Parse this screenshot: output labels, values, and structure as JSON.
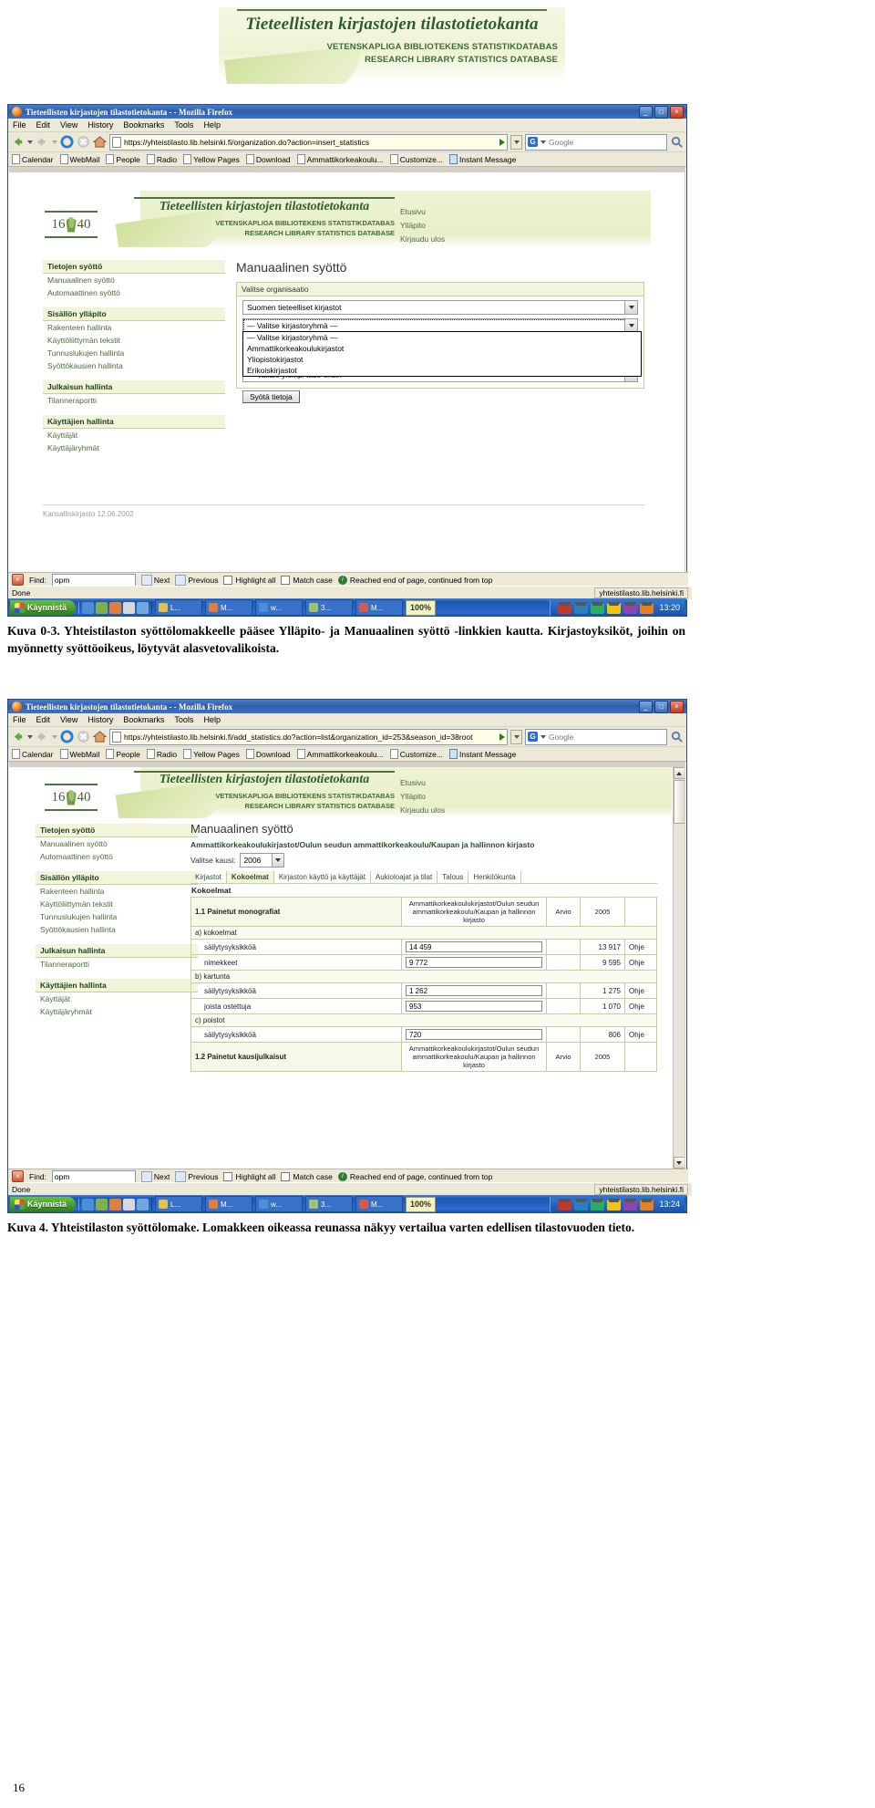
{
  "document": {
    "page_number": "16"
  },
  "top_banner": {
    "title": "Tieteellisten kirjastojen tilastotietokanta",
    "subtitle_sv": "VETENSKAPLIGA BIBLIOTEKENS STATISTIKDATABAS",
    "subtitle_en": "RESEARCH LIBRARY STATISTICS DATABASE"
  },
  "screenshot1": {
    "window": {
      "title": "Tieteellisten kirjastojen tilastotietokanta - - Mozilla Firefox",
      "minimize": "_",
      "maximize": "□",
      "close": "×"
    },
    "menu": [
      "File",
      "Edit",
      "View",
      "History",
      "Bookmarks",
      "Tools",
      "Help"
    ],
    "url": "https://yhteistilasto.lib.helsinki.fi/organization.do?action=insert_statistics",
    "search_engine": "Google",
    "bookmarks": [
      "Calendar",
      "WebMail",
      "People",
      "Radio",
      "Yellow Pages",
      "Download",
      "Ammattikorkeakoulu...",
      "Customize...",
      "Instant Message"
    ],
    "page": {
      "banner": {
        "title": "Tieteellisten kirjastojen tilastotietokanta",
        "subtitle_sv": "VETENSKAPLIGA BIBLIOTEKENS STATISTIKDATABAS",
        "subtitle_en": "RESEARCH LIBRARY STATISTICS DATABASE",
        "logo_left": "16",
        "logo_right": "40",
        "nav": [
          "Etusivu",
          "Ylläpito",
          "Kirjaudu ulos"
        ]
      },
      "sidebar": [
        {
          "heading": "Tietojen syöttö",
          "items": [
            "Manuaalinen syöttö",
            "Automaattinen syöttö"
          ]
        },
        {
          "heading": "Sisällön ylläpito",
          "items": [
            "Rakenteen hallinta",
            "Käyttöliittymän tekstit",
            "Tunnuslukujen hallinta",
            "Syöttökausien hallinta"
          ]
        },
        {
          "heading": "Julkaisun hallinta",
          "items": [
            "Tilanneraportti"
          ]
        },
        {
          "heading": "Käyttäjien hallinta",
          "items": [
            "Käyttäjät",
            "Käyttäjäryhmät"
          ]
        }
      ],
      "footer": "Kansalliskirjasto 12.06.2002",
      "main": {
        "heading": "Manuaalinen syöttö",
        "panel_title": "Valitse organisaatio",
        "select_top_value": "Suomen tieteelliset kirjastot",
        "select_open_value": "— Valitse kirjastoryhmä —",
        "options": [
          "— Valitse kirjastoryhmä —",
          "Ammattikorkeakoulukirjastot",
          "Yliopistokirjastot",
          "Erikoiskirjastot"
        ],
        "select_bottom_value": "— Valitse ylempi taso ensin —",
        "submit_label": "Syötä tietoja"
      }
    },
    "findbar": {
      "close": "×",
      "label": "Find:",
      "value": "opm",
      "next": "Next",
      "previous": "Previous",
      "highlight_all": "Highlight all",
      "match_case": "Match case",
      "message": "Reached end of page, continued from top"
    },
    "statusbar": {
      "status": "Done",
      "host": "yhteistilasto.lib.helsinki.fi"
    },
    "taskbar": {
      "start": "Käynnistä",
      "tasks": [
        "L...",
        "M...",
        "w...",
        "3...",
        "M..."
      ],
      "zoom": "100%",
      "clock": "13:20"
    }
  },
  "caption1": {
    "figure": "Kuva 0-3.",
    "text": "Yhteistilaston syöttölomakkeelle pääsee Ylläpito- ja Manuaalinen syöttö -linkkien kautta. Kirjastoyksiköt, joihin on myönnetty syöttöoikeus, löytyvät alasvetovalikoista."
  },
  "screenshot2": {
    "window": {
      "title": "Tieteellisten kirjastojen tilastotietokanta - - Mozilla Firefox",
      "minimize": "_",
      "maximize": "□",
      "close": "×"
    },
    "menu": [
      "File",
      "Edit",
      "View",
      "History",
      "Bookmarks",
      "Tools",
      "Help"
    ],
    "url": "https://yhteistilasto.lib.helsinki.fi/add_statistics.do?action=list&organization_id=253&season_id=38root",
    "search_engine": "Google",
    "bookmarks": [
      "Calendar",
      "WebMail",
      "People",
      "Radio",
      "Yellow Pages",
      "Download",
      "Ammattikorkeakoulu...",
      "Customize...",
      "Instant Message"
    ],
    "page": {
      "banner": {
        "title": "Tieteellisten kirjastojen tilastotietokanta",
        "subtitle_sv": "VETENSKAPLIGA BIBLIOTEKENS STATISTIKDATABAS",
        "subtitle_en": "RESEARCH LIBRARY STATISTICS DATABASE",
        "logo_left": "16",
        "logo_right": "40",
        "nav": [
          "Etusivu",
          "Ylläpito",
          "Kirjaudu ulos"
        ]
      },
      "sidebar": [
        {
          "heading": "Tietojen syöttö",
          "items": [
            "Manuaalinen syöttö",
            "Automaattinen syöttö"
          ]
        },
        {
          "heading": "Sisällön ylläpito",
          "items": [
            "Rakenteen hallinta",
            "Käyttöliittymän tekstit",
            "Tunnuslukujen hallinta",
            "Syöttökausien hallinta"
          ]
        },
        {
          "heading": "Julkaisun hallinta",
          "items": [
            "Tilanneraportti"
          ]
        },
        {
          "heading": "Käyttäjien hallinta",
          "items": [
            "Käyttäjät",
            "Käyttäjäryhmät"
          ]
        }
      ],
      "main": {
        "heading": "Manuaalinen syöttö",
        "breadcrumb": "Ammattikorkeakoulukirjastot/Oulun seudun ammattikorkeakoulu/Kaupan ja hallinnon kirjasto",
        "season_label": "Valitse kausi:",
        "season_value": "2006",
        "tabs": [
          "Kirjastot",
          "Kokoelmat",
          "Kirjaston käyttö ja käyttäjät",
          "Aukioloajat ja tilat",
          "Talous",
          "Henkilökunta"
        ],
        "active_tab": "Kokoelmat",
        "section_title": "Kokoelmat",
        "col_org": "Ammattikorkeakoulukirjastot/Oulun seudun ammattikorkeakoulu/Kaupan ja hallinnon kirjasto",
        "col_arvio": "Arvio",
        "col_year": "2005",
        "help_label": "Ohje",
        "rows": [
          {
            "type": "section",
            "label": "1.1 Painetut monografiat"
          },
          {
            "type": "group",
            "label": "a) kokoelmat"
          },
          {
            "type": "field",
            "label": "säilytysyksikköä",
            "value": "14 459",
            "previous": "13 917"
          },
          {
            "type": "field",
            "label": "nimekkeet",
            "value": "9 772",
            "previous": "9 595"
          },
          {
            "type": "group",
            "label": "b) kartunta"
          },
          {
            "type": "field",
            "label": "säilytysyksikköä",
            "value": "1 262",
            "previous": "1 275"
          },
          {
            "type": "field",
            "label": "joista ostettuja",
            "value": "953",
            "previous": "1 070"
          },
          {
            "type": "group",
            "label": "c) poistot"
          },
          {
            "type": "field",
            "label": "säilytysyksikköä",
            "value": "720",
            "previous": "806"
          },
          {
            "type": "section",
            "label": "1.2 Painetut kausijulkaisut"
          }
        ]
      }
    },
    "findbar": {
      "close": "×",
      "label": "Find:",
      "value": "opm",
      "next": "Next",
      "previous": "Previous",
      "highlight_all": "Highlight all",
      "match_case": "Match case",
      "message": "Reached end of page, continued from top"
    },
    "statusbar": {
      "status": "Done",
      "host": "yhteistilasto.lib.helsinki.fi"
    },
    "taskbar": {
      "start": "Käynnistä",
      "tasks": [
        "L...",
        "M...",
        "w...",
        "3...",
        "M..."
      ],
      "zoom": "100%",
      "clock": "13:24"
    }
  },
  "caption2": {
    "figure": "Kuva 4.",
    "text": "Yhteistilaston syöttölomake. Lomakkeen oikeassa reunassa näkyy vertailua varten edellisen tilastovuoden tieto."
  }
}
